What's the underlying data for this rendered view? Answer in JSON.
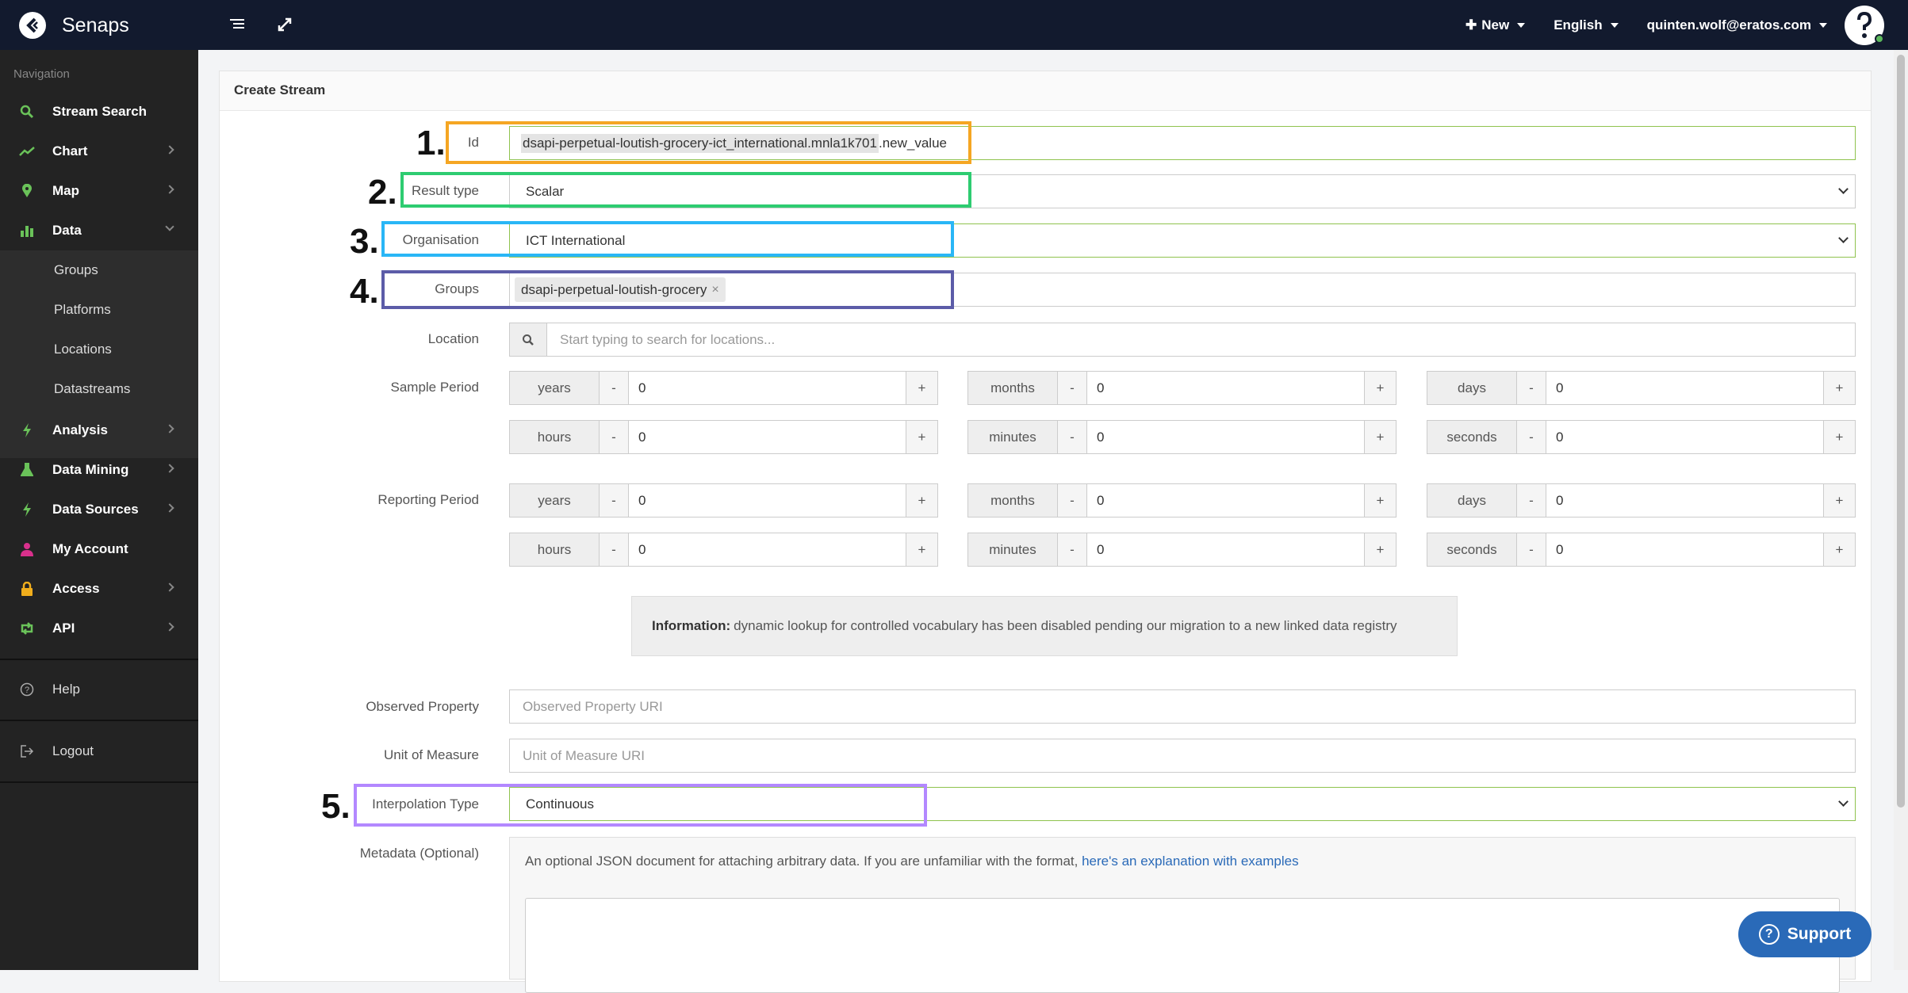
{
  "topbar": {
    "brand": "Senaps",
    "new_label": "New",
    "language": "English",
    "user": "quinten.wolf@eratos.com"
  },
  "sidebar": {
    "caption": "Navigation",
    "items": [
      {
        "label": "Stream Search"
      },
      {
        "label": "Chart"
      },
      {
        "label": "Map"
      },
      {
        "label": "Data"
      },
      {
        "label": "Analysis"
      },
      {
        "label": "Data Mining"
      },
      {
        "label": "Data Sources"
      },
      {
        "label": "My Account"
      },
      {
        "label": "Access"
      },
      {
        "label": "API"
      }
    ],
    "data_sub": [
      "Groups",
      "Platforms",
      "Locations",
      "Datastreams"
    ],
    "help": "Help",
    "logout": "Logout"
  },
  "form": {
    "title": "Create Stream",
    "id_label": "Id",
    "id_prefix": "dsapi-perpetual-loutish-grocery-ict_international.mnla1k701",
    "id_suffix": ".new_value",
    "result_type_label": "Result type",
    "result_type": "Scalar",
    "organisation_label": "Organisation",
    "organisation": "ICT International",
    "groups_label": "Groups",
    "groups_tag": "dsapi-perpetual-loutish-grocery",
    "location_label": "Location",
    "location_placeholder": "Start typing to search for locations...",
    "sample_period_label": "Sample Period",
    "reporting_period_label": "Reporting Period",
    "units": {
      "years": "years",
      "months": "months",
      "days": "days",
      "hours": "hours",
      "minutes": "minutes",
      "seconds": "seconds"
    },
    "zero": "0",
    "minus": "-",
    "plus": "+",
    "info_bold": "Information:",
    "info_text": "dynamic lookup for controlled vocabulary has been disabled pending our migration to a new linked data registry",
    "observed_property_label": "Observed Property",
    "observed_property_placeholder": "Observed Property URI",
    "unit_label": "Unit of Measure",
    "unit_placeholder": "Unit of Measure URI",
    "interpolation_label": "Interpolation Type",
    "interpolation": "Continuous",
    "metadata_label": "Metadata (Optional)",
    "metadata_desc": "An optional JSON document for attaching arbitrary data. If you are unfamiliar with the format,",
    "metadata_link": "here's an explanation with examples"
  },
  "annotations": [
    "1.",
    "2.",
    "3.",
    "4.",
    "5."
  ],
  "support_label": "Support",
  "colors": {
    "anno1": "#f5a623",
    "anno2": "#2ecc71",
    "anno3": "#29b6f6",
    "anno4": "#5c5ca8",
    "anno5": "#b388ff",
    "accent": "#2a6ab8"
  }
}
